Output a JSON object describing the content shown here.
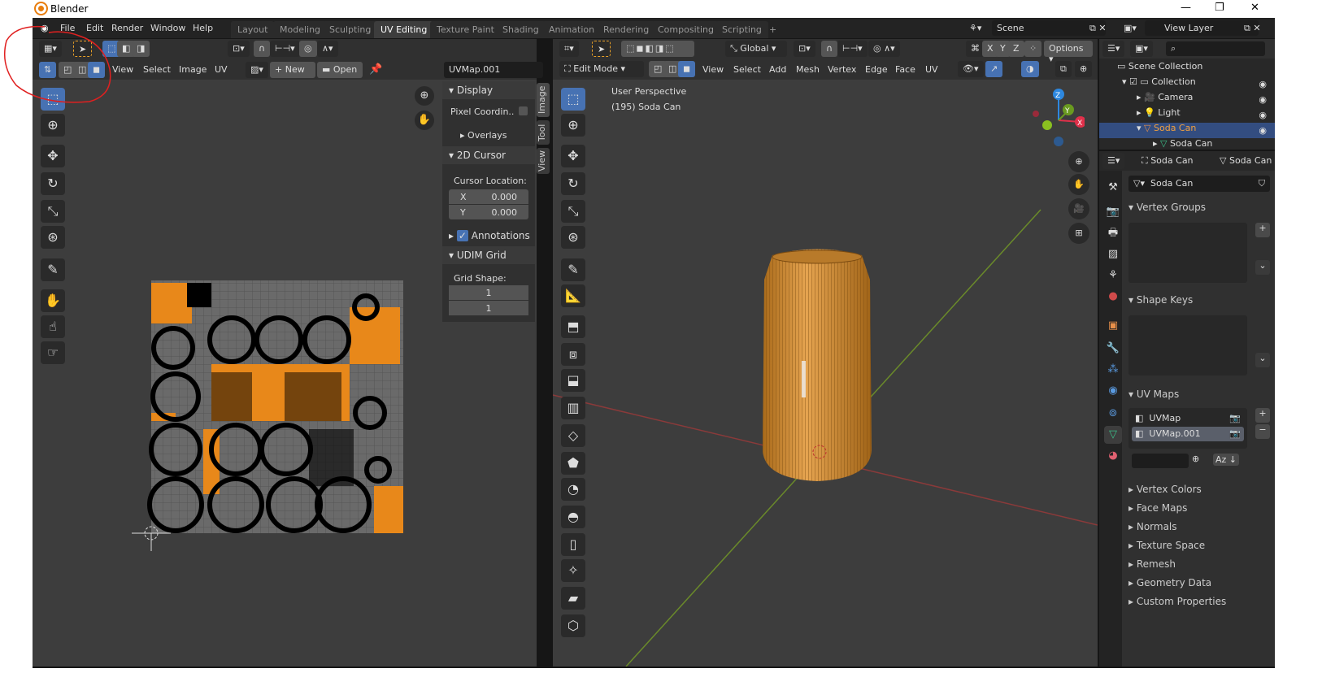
{
  "window": {
    "title": "Blender",
    "minimize": "—",
    "maximize": "❐",
    "close": "✕"
  },
  "menu": [
    "File",
    "Edit",
    "Render",
    "Window",
    "Help"
  ],
  "workspaces": [
    "Layout",
    "Modeling",
    "Sculpting",
    "UV Editing",
    "Texture Paint",
    "Shading",
    "Animation",
    "Rendering",
    "Compositing",
    "Scripting",
    "+"
  ],
  "active_workspace": "UV Editing",
  "scene": {
    "label": "Scene",
    "view_layer": "View Layer"
  },
  "uv_editor": {
    "menus": [
      "View",
      "Select",
      "Image",
      "UV"
    ],
    "new": "New",
    "open": "Open",
    "uvmap_field": "UVMap.001",
    "sidebar": {
      "display": "Display",
      "pixel_coords": "Pixel Coordin..",
      "overlays": "Overlays",
      "cursor": "2D Cursor",
      "cursor_loc": "Cursor Location:",
      "x_label": "X",
      "x_val": "0.000",
      "y_label": "Y",
      "y_val": "0.000",
      "annotations": "Annotations",
      "udim": "UDIM Grid",
      "grid_shape": "Grid Shape:",
      "grid_x": "1",
      "grid_y": "1"
    },
    "tabs": [
      "Image",
      "Tool",
      "View"
    ]
  },
  "viewport": {
    "mode": "Edit Mode",
    "menus": [
      "View",
      "Select",
      "Add",
      "Mesh",
      "Vertex",
      "Edge",
      "Face",
      "UV"
    ],
    "orientation": "Global",
    "options": "Options",
    "axes": [
      "X",
      "Y",
      "Z"
    ],
    "info_line1": "User Perspective",
    "info_line2": "(195) Soda Can",
    "gizmo": {
      "x": "X",
      "y": "Y",
      "z": "Z"
    }
  },
  "outliner": {
    "scene_collection": "Scene Collection",
    "items": [
      {
        "name": "Collection"
      },
      {
        "name": "Camera"
      },
      {
        "name": "Light"
      },
      {
        "name": "Soda Can"
      },
      {
        "name": "Soda Can"
      }
    ]
  },
  "properties": {
    "object": "Soda Can",
    "data": "Soda Can",
    "mesh_name": "Soda Can",
    "vertex_groups": "Vertex Groups",
    "shape_keys": "Shape Keys",
    "uv_maps": "UV Maps",
    "uv_list": [
      "UVMap",
      "UVMap.001"
    ],
    "collapsed": [
      "Vertex Colors",
      "Face Maps",
      "Normals",
      "Texture Space",
      "Remesh",
      "Geometry Data",
      "Custom Properties"
    ]
  },
  "colors": {
    "accent": "#4772b3",
    "orange": "#e8881a",
    "bg": "#3d3d3d"
  }
}
